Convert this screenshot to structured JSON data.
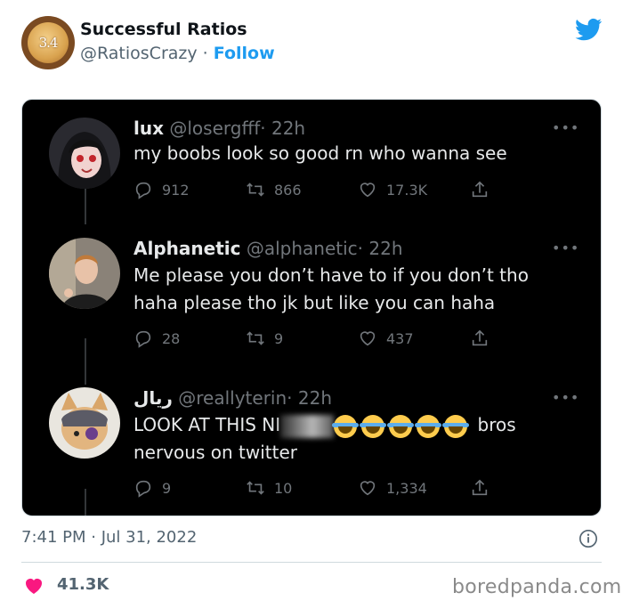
{
  "header": {
    "display_name": "Successful Ratios",
    "handle": "@RatiosCrazy",
    "separator": "·",
    "follow_label": "Follow",
    "avatar_text": "3.4"
  },
  "embedded_thread": {
    "tweets": [
      {
        "name": "lux",
        "handle": "@losergfff",
        "time": "· 22h",
        "text_lines": [
          "my boobs look so good rn who wanna see"
        ],
        "replies": "912",
        "retweets": "866",
        "likes": "17.3K"
      },
      {
        "name": "Alphanetic",
        "handle": "@alphanetic",
        "time": "· 22h",
        "text_lines": [
          "Me please you don’t have to if you don’t tho",
          "haha please tho jk but like you can haha"
        ],
        "replies": "28",
        "retweets": "9",
        "likes": "437"
      },
      {
        "name": "ريال",
        "handle": "@reallyterin",
        "time": "· 22h",
        "text_line1_start": "LOOK AT THIS NI",
        "text_line1_end": "bros",
        "text_line2": "nervous on twitter",
        "replies": "9",
        "retweets": "10",
        "likes": "1,334"
      }
    ]
  },
  "footer": {
    "timestamp": "7:41 PM · Jul 31, 2022",
    "like_count": "41.3K",
    "watermark": "boredpanda.com"
  },
  "colors": {
    "link_blue": "#1d9bf0",
    "heart_pink": "#f91880",
    "muted_gray": "#536471"
  }
}
